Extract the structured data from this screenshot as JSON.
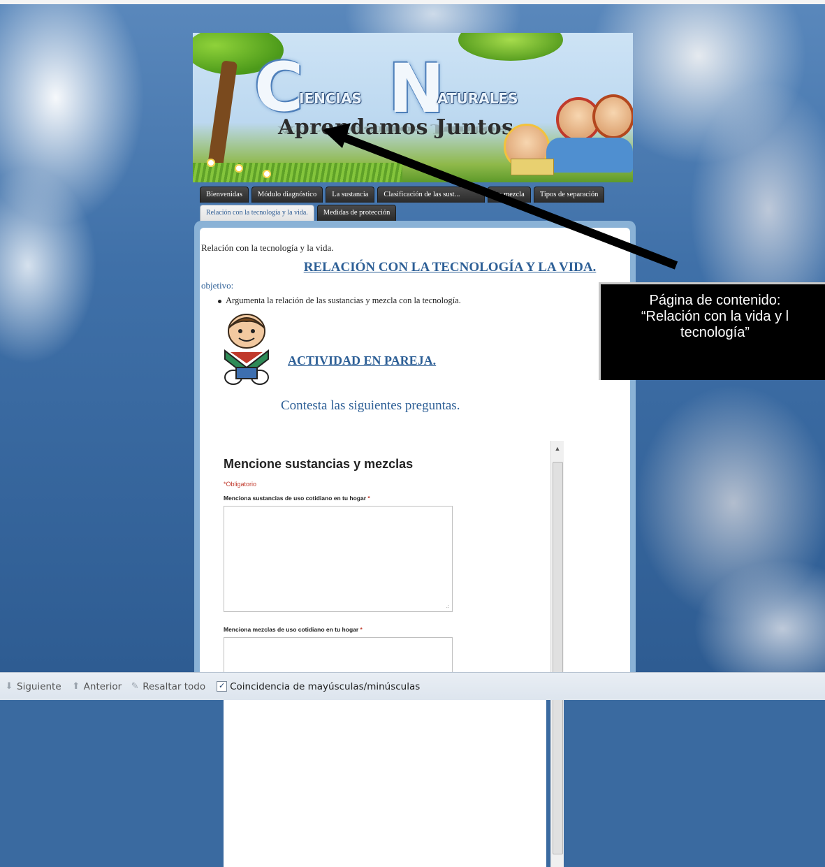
{
  "banner": {
    "logo_word1": "IENCIAS",
    "logo_word2": "ATURALES",
    "logo_letter1": "C",
    "logo_letter2": "N",
    "subtitle": "Aprendamos Juntos"
  },
  "tabs_row1": [
    {
      "label": "Bienvenidas"
    },
    {
      "label": "Módulo diagnóstico"
    },
    {
      "label": "La sustancia"
    },
    {
      "label": "Clasificación de las sust..."
    },
    {
      "label": "La mezcla"
    },
    {
      "label": "Tipos de separación"
    }
  ],
  "tabs_row2": [
    {
      "label": "Relación con la tecnología y la vida.",
      "active": true
    },
    {
      "label": "Medidas de protección"
    }
  ],
  "content": {
    "breadcrumb": "Relación con la tecnología y la vida.",
    "heading": "RELACIÓN CON LA TECNOLOGÍA Y LA VIDA.",
    "objective_label": "objetivo:",
    "objective_item": "Argumenta la relación de las sustancias y mezcla con la tecnología.",
    "activity": "ACTIVIDAD EN PAREJA.",
    "instruction": "Contesta las siguientes preguntas."
  },
  "form": {
    "title": "Mencione sustancias y mezclas",
    "required_note": "*Obligatorio",
    "q1": "Menciona sustancias de uso cotidiano en tu hogar",
    "q2": "Menciona mezclas de uso cotidiano en tu hogar",
    "required_mark": "*"
  },
  "callout": {
    "line1": "Página de contenido:",
    "line2": "“Relación con la vida y l",
    "line3": "tecnología”"
  },
  "findbar": {
    "next": "Siguiente",
    "previous": "Anterior",
    "highlight_all": "Resaltar todo",
    "match_case": "Coincidencia de mayúsculas/minúsculas",
    "match_case_checked": true,
    "icons": [
      "arrow-down-icon",
      "arrow-up-icon",
      "highlighter-icon",
      "checkbox-icon"
    ]
  },
  "colors": {
    "link_blue": "#2d5f96",
    "tab_dark": "#2a2a2a",
    "required_red": "#c0392b"
  }
}
